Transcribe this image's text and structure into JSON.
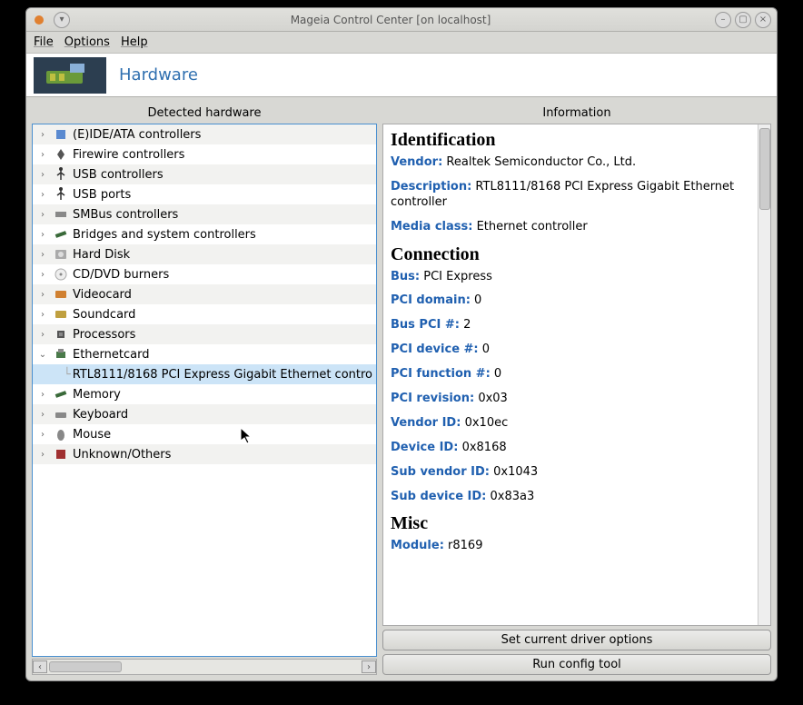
{
  "window": {
    "title": "Mageia Control Center  [on localhost]"
  },
  "menubar": {
    "file": "File",
    "options": "Options",
    "help": "Help"
  },
  "banner": {
    "title": "Hardware"
  },
  "left": {
    "header": "Detected hardware",
    "items": [
      {
        "label": "(E)IDE/ATA controllers",
        "icon": "chip-icon",
        "twisty": "›"
      },
      {
        "label": "Firewire controllers",
        "icon": "firewire-icon",
        "twisty": "›"
      },
      {
        "label": "USB controllers",
        "icon": "usb-icon",
        "twisty": "›"
      },
      {
        "label": "USB ports",
        "icon": "usb-icon",
        "twisty": "›"
      },
      {
        "label": "SMBus controllers",
        "icon": "smbus-icon",
        "twisty": "›"
      },
      {
        "label": "Bridges and system controllers",
        "icon": "bridge-icon",
        "twisty": "›"
      },
      {
        "label": "Hard Disk",
        "icon": "harddisk-icon",
        "twisty": "›"
      },
      {
        "label": "CD/DVD burners",
        "icon": "disc-icon",
        "twisty": "›"
      },
      {
        "label": "Videocard",
        "icon": "video-icon",
        "twisty": "›"
      },
      {
        "label": "Soundcard",
        "icon": "sound-icon",
        "twisty": "›"
      },
      {
        "label": "Processors",
        "icon": "cpu-icon",
        "twisty": "›"
      },
      {
        "label": "Ethernetcard",
        "icon": "ethernet-icon",
        "twisty": "⌄",
        "expanded": true
      },
      {
        "label": "RTL8111/8168 PCI Express Gigabit Ethernet contro",
        "icon": "",
        "indent": 1,
        "selected": true
      },
      {
        "label": "Memory",
        "icon": "memory-icon",
        "twisty": "›"
      },
      {
        "label": "Keyboard",
        "icon": "keyboard-icon",
        "twisty": "›"
      },
      {
        "label": "Mouse",
        "icon": "mouse-icon",
        "twisty": "›"
      },
      {
        "label": "Unknown/Others",
        "icon": "unknown-icon",
        "twisty": "›"
      }
    ]
  },
  "right": {
    "header": "Information",
    "sections": {
      "identification": {
        "title": "Identification",
        "vendor_k": "Vendor:",
        "vendor_v": "Realtek Semiconductor Co., Ltd.",
        "description_k": "Description:",
        "description_v": "RTL8111/8168 PCI Express Gigabit Ethernet controller",
        "media_k": "Media class:",
        "media_v": "Ethernet controller"
      },
      "connection": {
        "title": "Connection",
        "bus_k": "Bus:",
        "bus_v": "PCI Express",
        "pcidomain_k": "PCI domain:",
        "pcidomain_v": "0",
        "buspci_k": "Bus PCI #:",
        "buspci_v": "2",
        "pcidev_k": "PCI device #:",
        "pcidev_v": "0",
        "pcifunc_k": "PCI function #:",
        "pcifunc_v": "0",
        "pcirev_k": "PCI revision:",
        "pcirev_v": "0x03",
        "vendorid_k": "Vendor ID:",
        "vendorid_v": "0x10ec",
        "deviceid_k": "Device ID:",
        "deviceid_v": "0x8168",
        "subvendor_k": "Sub vendor ID:",
        "subvendor_v": "0x1043",
        "subdevice_k": "Sub device ID:",
        "subdevice_v": "0x83a3"
      },
      "misc": {
        "title": "Misc",
        "module_k": "Module:",
        "module_v": "r8169"
      }
    },
    "buttons": {
      "driver": "Set current driver options",
      "config": "Run config tool"
    }
  }
}
